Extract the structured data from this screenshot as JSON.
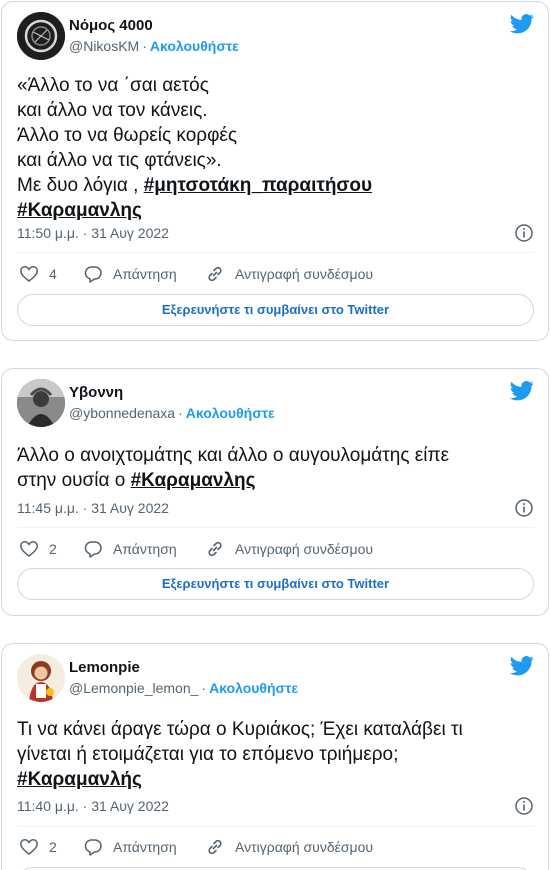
{
  "tweets": [
    {
      "name": "Νόμος 4000",
      "handle": "@NikosKM",
      "follow": "Ακολουθήστε",
      "lines": [
        "«Άλλο το να ΄σαι αετός",
        "και άλλο να τον κάνεις.",
        "Άλλο το να θωρείς κορφές",
        "και άλλο να τις φτάνεις».",
        "Με δυο λόγια ,"
      ],
      "hashtag_inline": "#μητσοτάκη_παραιτήσου",
      "hashtag_last": "#Καραμανλης",
      "time": "11:50 μ.μ. · 31 Αυγ 2022",
      "likes": "4",
      "reply": "Απάντηση",
      "copy": "Αντιγραφή συνδέσμου",
      "explore": "Εξερευνήστε τι συμβαίνει στο Twitter"
    },
    {
      "name": "Υβοννη",
      "handle": "@ybonnedenaxa",
      "follow": "Ακολουθήστε",
      "line1": "Άλλο ο ανοιχτομάτης και άλλο ο αυγουλομάτης είπε",
      "line2": "στην ουσία ο",
      "hashtag": "#Καραμανλης",
      "time": "11:45 μ.μ. · 31 Αυγ 2022",
      "likes": "2",
      "reply": "Απάντηση",
      "copy": "Αντιγραφή συνδέσμου",
      "explore": "Εξερευνήστε τι συμβαίνει στο Twitter"
    },
    {
      "name": "Lemonpie",
      "handle": "@Lemonpie_lemon_",
      "follow": "Ακολουθήστε",
      "line1": "Τι να κάνει άραγε τώρα ο Κυριάκος; Έχει καταλάβει τι",
      "line2": "γίνεται ή ετοιμάζεται για το επόμενο τριήμερο;",
      "hashtag": "#Καραμανλής",
      "time": "11:40 μ.μ. · 31 Αυγ 2022",
      "likes": "2",
      "reply": "Απάντηση",
      "copy": "Αντιγραφή συνδέσμου"
    }
  ],
  "colors": {
    "accent": "#1d9bf0",
    "text": "#0f1419",
    "muted": "#536471",
    "border": "#cfd9de"
  },
  "icons": [
    "twitter-bird-icon",
    "info-icon",
    "heart-icon",
    "reply-bubble-icon",
    "link-icon"
  ]
}
